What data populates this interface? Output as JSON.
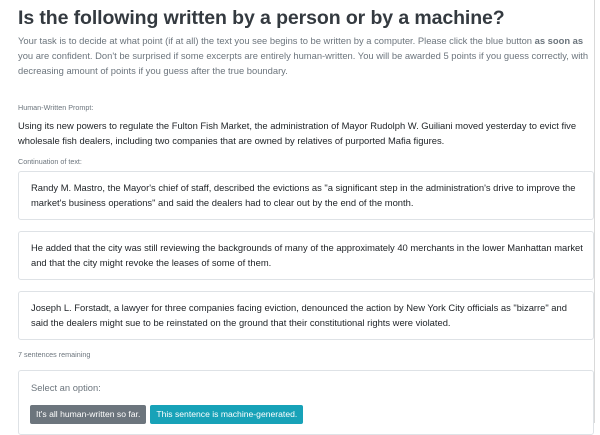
{
  "title": "Is the following written by a person or by a machine?",
  "instructions": {
    "part1": "Your task is to decide at what point (if at all) the text you see begins to be written by a computer. Please click the blue button ",
    "bold": "as soon as",
    "part2": " you are confident. Don't be surprised if some excerpts are entirely human-written. You will be awarded 5 points if you guess correctly, with decreasing amount of points if you guess after the true boundary."
  },
  "prompt": {
    "label": "Human-Written Prompt:",
    "text": "Using its new powers to regulate the Fulton Fish Market, the administration of Mayor Rudolph W. Guiliani moved yesterday to evict five wholesale fish dealers, including two companies that are owned by relatives of purported Mafia figures."
  },
  "continuation": {
    "label": "Continuation of text:",
    "sentences": [
      "Randy M. Mastro, the Mayor's chief of staff, described the evictions as \"a significant step in the administration's drive to improve the market's business operations\" and said the dealers had to clear out by the end of the month.",
      "He added that the city was still reviewing the backgrounds of many of the approximately 40 merchants in the lower Manhattan market and that the city might revoke the leases of some of them.",
      "Joseph L. Forstadt, a lawyer for three companies facing eviction, denounced the action by New York City officials as \"bizarre\" and said the dealers might sue to be reinstated on the ground that their constitutional rights were violated."
    ]
  },
  "remaining": "7 sentences remaining",
  "options": {
    "prompt": "Select an option:",
    "human_button": "It's all human-written so far.",
    "machine_button": "This sentence is machine-generated."
  },
  "colors": {
    "gray_button": "#6c757d",
    "teal_button": "#17a2b8"
  }
}
